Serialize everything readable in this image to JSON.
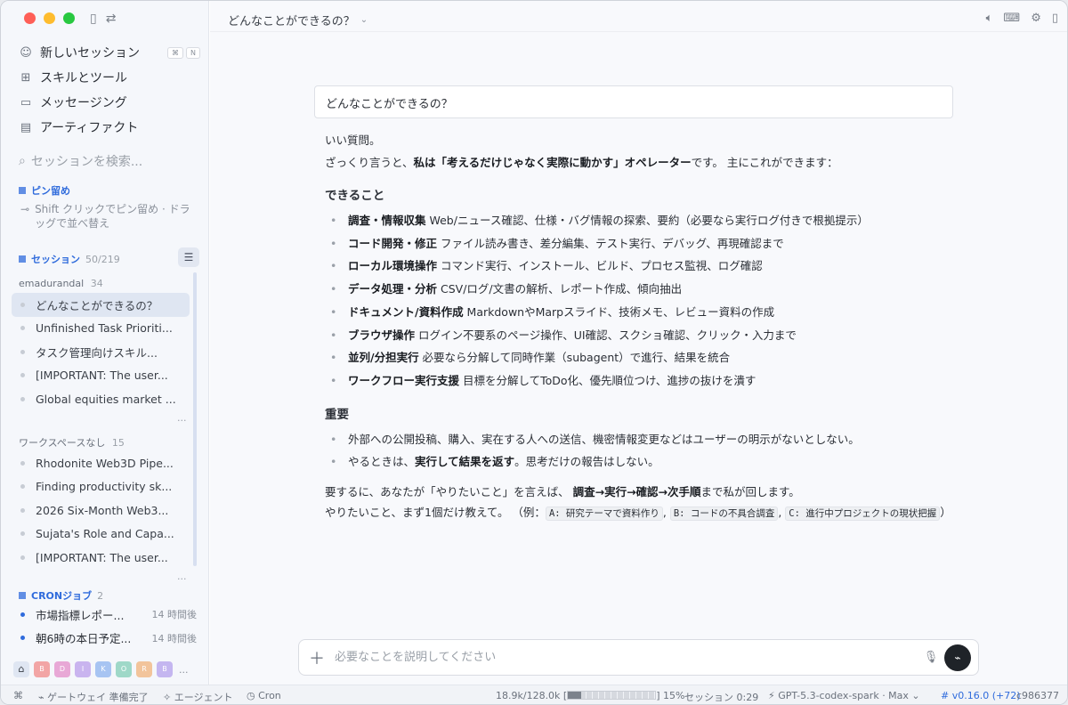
{
  "sidebar": {
    "nav": [
      {
        "label": "新しいセッション",
        "icon": "person-icon",
        "kbd": [
          "⌘",
          "N"
        ]
      },
      {
        "label": "スキルとツール",
        "icon": "gift-icon"
      },
      {
        "label": "メッセージング",
        "icon": "chat-icon"
      },
      {
        "label": "アーティファクト",
        "icon": "file-icon"
      }
    ],
    "search_placeholder": "セッションを検索...",
    "pinned": {
      "title": "ピン留め",
      "hint": "Shift クリックでピン留め · ドラッグで並べ替え"
    },
    "sessions": {
      "title": "セッション",
      "count": "50/219",
      "groups": [
        {
          "label": "emadurandal",
          "count": "34",
          "items": [
            "どんなことができるの？",
            "Unfinished Task Prioriti...",
            "タスク管理向けスキル...",
            "[IMPORTANT: The user...",
            "Global equities market ..."
          ]
        },
        {
          "label": "ワークスペースなし",
          "count": "15",
          "items": [
            "Rhodonite Web3D Pipe...",
            "Finding productivity sk...",
            "2026 Six-Month Web3...",
            "Sujata's Role and Capa...",
            "[IMPORTANT: The user..."
          ]
        }
      ],
      "more": "..."
    },
    "cron": {
      "title": "CRONジョブ",
      "count": "2",
      "items": [
        {
          "label": "市場指標レポー...",
          "when": "14 時間後"
        },
        {
          "label": "朝6時の本日予定...",
          "when": "14 時間後"
        }
      ]
    },
    "workspaces": [
      {
        "letter": "B",
        "color": "#f2a5a5"
      },
      {
        "letter": "D",
        "color": "#e8a8d6"
      },
      {
        "letter": "I",
        "color": "#c9b4ef"
      },
      {
        "letter": "K",
        "color": "#a7c4f2"
      },
      {
        "letter": "O",
        "color": "#9fd8c8"
      },
      {
        "letter": "R",
        "color": "#f2c49b"
      },
      {
        "letter": "B",
        "color": "#c4b6f0"
      }
    ],
    "workspaces_more": "..."
  },
  "main": {
    "title": "どんなことができるの？",
    "user_message": "どんなことができるの？",
    "answer": {
      "p1": "いい質問。",
      "p2_pre": "ざっくり言うと、",
      "p2_bold": "私は「考えるだけじゃなく実際に動かす」オペレーター",
      "p2_post": "です。 主にこれができます：",
      "h_can": "できること",
      "can": [
        {
          "b": "調査・情報収集",
          "t": " Web/ニュース確認、仕様・バグ情報の探索、要約（必要なら実行ログ付きで根拠提示）"
        },
        {
          "b": "コード開発・修正",
          "t": " ファイル読み書き、差分編集、テスト実行、デバッグ、再現確認まで"
        },
        {
          "b": "ローカル環境操作",
          "t": " コマンド実行、インストール、ビルド、プロセス監視、ログ確認"
        },
        {
          "b": "データ処理・分析",
          "t": " CSV/ログ/文書の解析、レポート作成、傾向抽出"
        },
        {
          "b": "ドキュメント/資料作成",
          "t": " MarkdownやMarpスライド、技術メモ、レビュー資料の作成"
        },
        {
          "b": "ブラウザ操作",
          "t": " ログイン不要系のページ操作、UI確認、スクショ確認、クリック・入力まで"
        },
        {
          "b": "並列/分担実行",
          "t": " 必要なら分解して同時作業（subagent）で進行、結果を統合"
        },
        {
          "b": "ワークフロー実行支援",
          "t": " 目標を分解してToDo化、優先順位つけ、進捗の抜けを潰す"
        }
      ],
      "h_important": "重要",
      "imp1": "外部への公開投稿、購入、実在する人への送信、機密情報変更などはユーザーの明示がないとしない。",
      "imp2_pre": "やるときは、",
      "imp2_bold": "実行して結果を返す",
      "imp2_post": "。思考だけの報告はしない。",
      "sum_pre": "要するに、あなたが「やりたいこと」を言えば、 ",
      "sum_bold": "調査→実行→確認→次手順",
      "sum_post": "まで私が回します。",
      "ask_pre": "やりたいこと、まず1個だけ教えて。 （例：",
      "ex1": "A: 研究テーマで資料作り",
      "ex2": "B: コードの不具合調査",
      "ex3": "C: 進行中プロジェクトの現状把握",
      "ask_post": "）"
    },
    "composer_placeholder": "必要なことを説明してください"
  },
  "status": {
    "gateway": "ゲートウェイ 準備完了",
    "agent": "エージェント",
    "cron": "Cron",
    "tokens": "18.9k/128.0k",
    "percent": "15%",
    "context_fraction": 0.15,
    "session_time": "セッション 0:29",
    "model": "GPT-5.3-codex-spark · Max",
    "version": "v0.16.0 (+72)",
    "commit": "c986377"
  }
}
